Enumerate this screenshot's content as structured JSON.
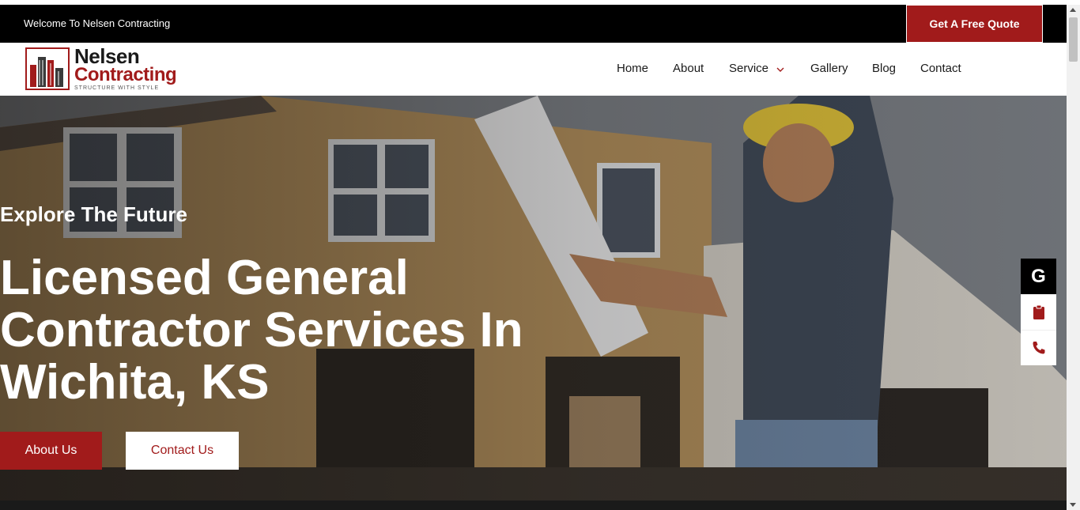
{
  "topbar": {
    "welcome_text": "Welcome To Nelsen Contracting",
    "quote_button": "Get A Free Quote"
  },
  "logo": {
    "name_line1": "Nelsen",
    "name_line2": "Contracting",
    "tagline": "STRUCTURE WITH STYLE"
  },
  "nav": {
    "items": [
      {
        "label": "Home"
      },
      {
        "label": "About"
      },
      {
        "label": "Service"
      },
      {
        "label": "Gallery"
      },
      {
        "label": "Blog"
      },
      {
        "label": "Contact"
      }
    ]
  },
  "hero": {
    "eyebrow": "Explore The Future",
    "headline": "Licensed General Contractor Services In Wichita, KS",
    "about_button": "About Us",
    "contact_button": "Contact Us"
  },
  "side_icons": {
    "google_glyph": "G",
    "items": [
      "google-icon",
      "clipboard-icon",
      "phone-icon"
    ]
  },
  "colors": {
    "brand_red": "#a11b1b",
    "black": "#000000",
    "white": "#ffffff"
  }
}
